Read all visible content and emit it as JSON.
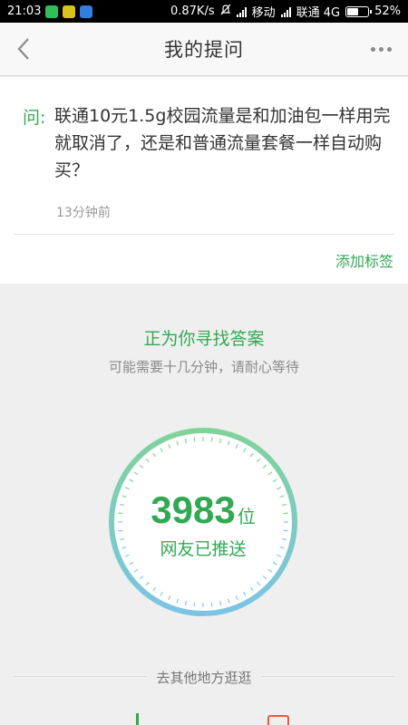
{
  "status_bar": {
    "time": "21:03",
    "speed": "0.87K/s",
    "carrier1": "移动",
    "carrier2": "联通 4G",
    "battery": "52%",
    "battery_level": 0.52,
    "icons": [
      "app-green-icon",
      "app-yellow-icon",
      "app-shield-icon",
      "mute-icon",
      "signal-icon",
      "battery-icon"
    ]
  },
  "header": {
    "title": "我的提问",
    "back_icon": "chevron-left-icon",
    "more_icon": "more-dots-icon"
  },
  "question": {
    "prefix": "问:",
    "text": "联通10元1.5g校园流量是和加油包一样用完就取消了，还是和普通流量套餐一样自动购买？",
    "time": "13分钟前",
    "add_tag": "添加标签"
  },
  "searching": {
    "title": "正为你寻找答案",
    "subtitle": "可能需要十几分钟，请耐心等待"
  },
  "dial": {
    "count": "3983",
    "unit": "位",
    "caption": "网友已推送"
  },
  "elsewhere": {
    "label": "去其他地方逛逛"
  },
  "colors": {
    "accent_green": "#31a952",
    "ring_start": "#7fd39a",
    "ring_end": "#7cc3e6",
    "status_bar_bg": "#000000",
    "page_bg": "#efefef",
    "bottom_icon_red": "#e85a3c"
  }
}
